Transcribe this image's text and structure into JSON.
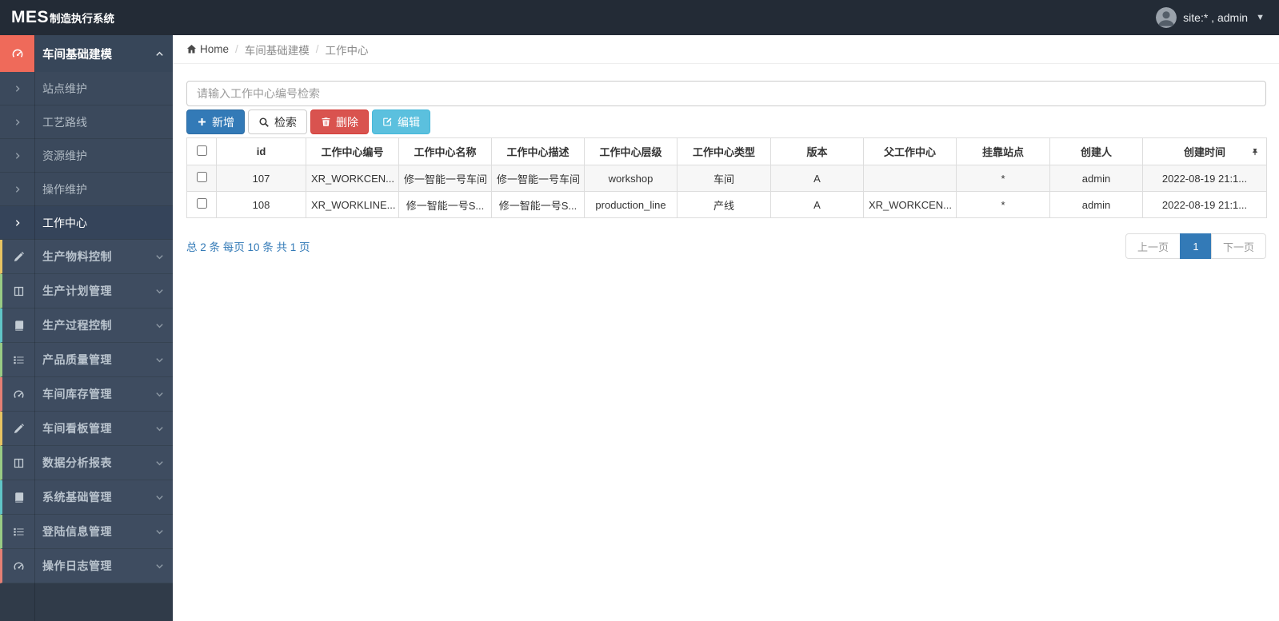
{
  "app": {
    "brand_bold": "MES",
    "brand_suffix": "制造执行系统",
    "user_label": "site:* , admin"
  },
  "sidebar": {
    "active_group": {
      "label": "车间基础建模",
      "icon": "dashboard-icon",
      "icon_bg": "#ef6a5a"
    },
    "submenu": [
      "站点维护",
      "工艺路线",
      "资源维护",
      "操作维护",
      "工作中心"
    ],
    "active_submenu": "工作中心",
    "groups": [
      {
        "label": "生产物料控制",
        "icon": "pencil-icon",
        "accent": "#e8c462"
      },
      {
        "label": "生产计划管理",
        "icon": "columns-icon",
        "accent": "#99cb84"
      },
      {
        "label": "生产过程控制",
        "icon": "book-icon",
        "accent": "#60c5c7"
      },
      {
        "label": "产品质量管理",
        "icon": "list-icon",
        "accent": "#99cb84"
      },
      {
        "label": "车间库存管理",
        "icon": "dashboard-icon",
        "accent": "#e57f74"
      },
      {
        "label": "车间看板管理",
        "icon": "pencil-icon",
        "accent": "#e8c462"
      },
      {
        "label": "数据分析报表",
        "icon": "columns-icon",
        "accent": "#99cb84"
      },
      {
        "label": "系统基础管理",
        "icon": "book-icon",
        "accent": "#60c5c7"
      },
      {
        "label": "登陆信息管理",
        "icon": "list-icon",
        "accent": "#99cb84"
      },
      {
        "label": "操作日志管理",
        "icon": "dashboard-icon",
        "accent": "#e57f74"
      }
    ]
  },
  "breadcrumb": {
    "home": "Home",
    "items": [
      "车间基础建模",
      "工作中心"
    ]
  },
  "toolbar": {
    "search_placeholder": "请输入工作中心编号检索",
    "add_label": "新增",
    "search_label": "检索",
    "delete_label": "删除",
    "edit_label": "编辑"
  },
  "table": {
    "columns": [
      "id",
      "工作中心编号",
      "工作中心名称",
      "工作中心描述",
      "工作中心层级",
      "工作中心类型",
      "版本",
      "父工作中心",
      "挂靠站点",
      "创建人",
      "创建时间"
    ],
    "rows": [
      [
        "107",
        "XR_WORKCEN...",
        "修一智能一号车间",
        "修一智能一号车间",
        "workshop",
        "车间",
        "A",
        "",
        "*",
        "admin",
        "2022-08-19 21:1..."
      ],
      [
        "108",
        "XR_WORKLINE...",
        "修一智能一号S...",
        "修一智能一号S...",
        "production_line",
        "产线",
        "A",
        "XR_WORKCEN...",
        "*",
        "admin",
        "2022-08-19 21:1..."
      ]
    ]
  },
  "pagination": {
    "summary": "总 2 条  每页 10 条  共 1 页",
    "prev_label": "上一页",
    "current_page": "1",
    "next_label": "下一页"
  },
  "colors": {
    "navbar_bg": "#232b36",
    "sidebar_bg": "#3e4c60",
    "primary": "#337ab7",
    "danger": "#d9534f",
    "info": "#5bc0de",
    "active_icon_bg": "#ef6a5a"
  }
}
